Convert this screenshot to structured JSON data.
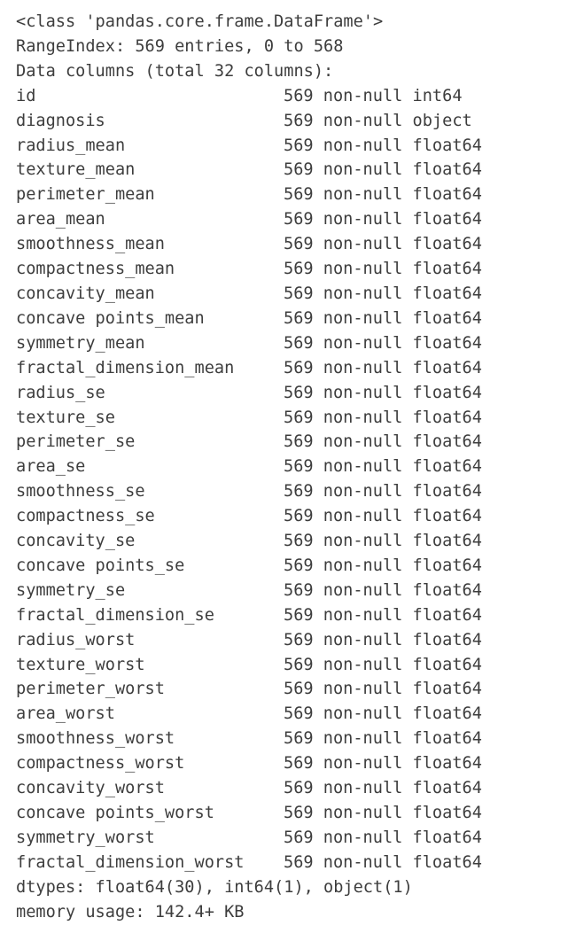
{
  "output": {
    "kind": "pandas-dataframe-info",
    "header_lines": [
      "<class 'pandas.core.frame.DataFrame'>",
      "RangeIndex: 569 entries, 0 to 568",
      "Data columns (total 32 columns):"
    ],
    "class_line": "<class 'pandas.core.frame.DataFrame'>",
    "range_index_line": "RangeIndex: 569 entries, 0 to 568",
    "data_columns_line": "Data columns (total 32 columns):",
    "dtypes_line": "dtypes: float64(30), int64(1), object(1)",
    "memory_usage_line": "memory usage: 142.4+ KB",
    "entry_count": 569,
    "index_start": 0,
    "index_end": 568,
    "total_columns": 32,
    "non_null_text": "569 non-null",
    "text_color": "#3d3d3d",
    "background_color": "#ffffff",
    "columns": [
      {
        "name": "id",
        "non_null": "569 non-null",
        "dtype": "int64"
      },
      {
        "name": "diagnosis",
        "non_null": "569 non-null",
        "dtype": "object"
      },
      {
        "name": "radius_mean",
        "non_null": "569 non-null",
        "dtype": "float64"
      },
      {
        "name": "texture_mean",
        "non_null": "569 non-null",
        "dtype": "float64"
      },
      {
        "name": "perimeter_mean",
        "non_null": "569 non-null",
        "dtype": "float64"
      },
      {
        "name": "area_mean",
        "non_null": "569 non-null",
        "dtype": "float64"
      },
      {
        "name": "smoothness_mean",
        "non_null": "569 non-null",
        "dtype": "float64"
      },
      {
        "name": "compactness_mean",
        "non_null": "569 non-null",
        "dtype": "float64"
      },
      {
        "name": "concavity_mean",
        "non_null": "569 non-null",
        "dtype": "float64"
      },
      {
        "name": "concave points_mean",
        "non_null": "569 non-null",
        "dtype": "float64"
      },
      {
        "name": "symmetry_mean",
        "non_null": "569 non-null",
        "dtype": "float64"
      },
      {
        "name": "fractal_dimension_mean",
        "non_null": "569 non-null",
        "dtype": "float64"
      },
      {
        "name": "radius_se",
        "non_null": "569 non-null",
        "dtype": "float64"
      },
      {
        "name": "texture_se",
        "non_null": "569 non-null",
        "dtype": "float64"
      },
      {
        "name": "perimeter_se",
        "non_null": "569 non-null",
        "dtype": "float64"
      },
      {
        "name": "area_se",
        "non_null": "569 non-null",
        "dtype": "float64"
      },
      {
        "name": "smoothness_se",
        "non_null": "569 non-null",
        "dtype": "float64"
      },
      {
        "name": "compactness_se",
        "non_null": "569 non-null",
        "dtype": "float64"
      },
      {
        "name": "concavity_se",
        "non_null": "569 non-null",
        "dtype": "float64"
      },
      {
        "name": "concave points_se",
        "non_null": "569 non-null",
        "dtype": "float64"
      },
      {
        "name": "symmetry_se",
        "non_null": "569 non-null",
        "dtype": "float64"
      },
      {
        "name": "fractal_dimension_se",
        "non_null": "569 non-null",
        "dtype": "float64"
      },
      {
        "name": "radius_worst",
        "non_null": "569 non-null",
        "dtype": "float64"
      },
      {
        "name": "texture_worst",
        "non_null": "569 non-null",
        "dtype": "float64"
      },
      {
        "name": "perimeter_worst",
        "non_null": "569 non-null",
        "dtype": "float64"
      },
      {
        "name": "area_worst",
        "non_null": "569 non-null",
        "dtype": "float64"
      },
      {
        "name": "smoothness_worst",
        "non_null": "569 non-null",
        "dtype": "float64"
      },
      {
        "name": "compactness_worst",
        "non_null": "569 non-null",
        "dtype": "float64"
      },
      {
        "name": "concavity_worst",
        "non_null": "569 non-null",
        "dtype": "float64"
      },
      {
        "name": "concave points_worst",
        "non_null": "569 non-null",
        "dtype": "float64"
      },
      {
        "name": "symmetry_worst",
        "non_null": "569 non-null",
        "dtype": "float64"
      },
      {
        "name": "fractal_dimension_worst",
        "non_null": "569 non-null",
        "dtype": "float64"
      }
    ]
  }
}
